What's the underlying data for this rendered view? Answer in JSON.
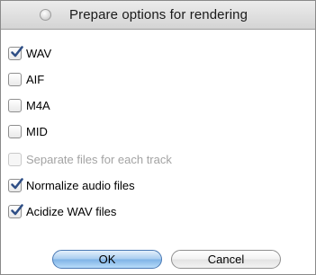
{
  "dialog": {
    "title": "Prepare options for rendering"
  },
  "formats": [
    {
      "label": "WAV",
      "checked": true,
      "enabled": true
    },
    {
      "label": "AIF",
      "checked": false,
      "enabled": true
    },
    {
      "label": "M4A",
      "checked": false,
      "enabled": true
    },
    {
      "label": "MID",
      "checked": false,
      "enabled": true
    }
  ],
  "options": [
    {
      "label": "Separate files for each track",
      "checked": false,
      "enabled": false
    },
    {
      "label": "Normalize audio files",
      "checked": true,
      "enabled": true
    },
    {
      "label": "Acidize WAV files",
      "checked": true,
      "enabled": true
    }
  ],
  "buttons": {
    "ok_label": "OK",
    "cancel_label": "Cancel"
  },
  "colors": {
    "default_button": "#a9cdf0",
    "check_mark": "#2f4f86",
    "disabled_text": "#a3a3a3"
  },
  "icons": {
    "title_bullet": "radio-bullet-icon",
    "check": "checkmark-icon"
  }
}
